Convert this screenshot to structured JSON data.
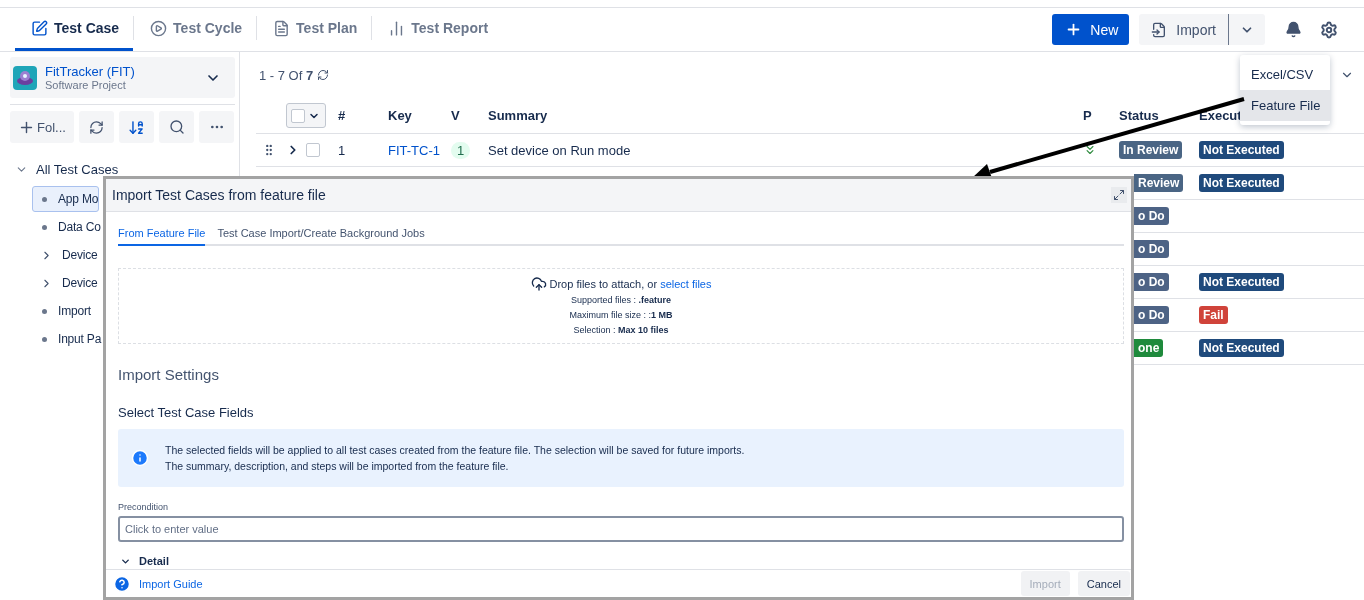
{
  "nav_tabs": [
    {
      "label": "Test Case",
      "selected": true
    },
    {
      "label": "Test Cycle",
      "selected": false
    },
    {
      "label": "Test Plan",
      "selected": false
    },
    {
      "label": "Test Report",
      "selected": false
    }
  ],
  "header_actions": {
    "new_button": "New",
    "import_button": "Import"
  },
  "import_menu": {
    "items": [
      {
        "label": "Excel/CSV",
        "selected": false
      },
      {
        "label": "Feature File",
        "selected": true
      }
    ]
  },
  "project": {
    "name": "FitTracker (FIT)",
    "type": "Software Project"
  },
  "sidebar_toolbar": {
    "folder_button": "Fol..."
  },
  "tree": {
    "label": "All Test Cases",
    "expanded": true,
    "children": [
      {
        "label": "App Mo",
        "kind": "leaf",
        "selected": true
      },
      {
        "label": "Data Co",
        "kind": "leaf",
        "selected": false
      },
      {
        "label": "Device",
        "kind": "folder",
        "selected": false
      },
      {
        "label": "Device",
        "kind": "folder",
        "selected": false
      },
      {
        "label": "Import",
        "kind": "leaf",
        "selected": false
      },
      {
        "label": "Input Pa",
        "kind": "leaf",
        "selected": false
      }
    ]
  },
  "count": "1 - 7 Of **7**",
  "table": {
    "columns": [
      "#",
      "Key",
      "V",
      "Summary",
      "P",
      "Status",
      "Execut"
    ],
    "rows": [
      {
        "kind": "full",
        "checked": false,
        "number": "1",
        "key": "FIT-TC-1",
        "version": "1",
        "summary": "Set device on Run mode",
        "status": {
          "text": "In Review",
          "color": "#4a6584"
        },
        "execution": {
          "text": "Not Executed",
          "color": "#1f4a7c"
        }
      },
      {
        "kind": "partial",
        "status": {
          "text": "Review",
          "color": "#4a6584"
        },
        "execution": {
          "text": "Not Executed",
          "color": "#1f4a7c"
        }
      },
      {
        "kind": "partial",
        "status": {
          "text": "o Do",
          "color": "#4d6385"
        }
      },
      {
        "kind": "partial",
        "status": {
          "text": "o Do",
          "color": "#4d6385"
        }
      },
      {
        "kind": "partial",
        "status": {
          "text": "o Do",
          "color": "#4d6385"
        },
        "execution": {
          "text": "Not Executed",
          "color": "#1f4a7c"
        }
      },
      {
        "kind": "partial",
        "status": {
          "text": "o Do",
          "color": "#4d6385"
        },
        "execution": {
          "text": "Fail",
          "color": "#d0433a"
        }
      },
      {
        "kind": "partial",
        "status": {
          "text": "one",
          "color": "#1e8a3c"
        },
        "execution": {
          "text": "Not Executed",
          "color": "#1f4a7c"
        }
      }
    ]
  },
  "dialog": {
    "title": "Import Test Cases from feature file",
    "tabs": [
      {
        "label": "From Feature File",
        "selected": true
      },
      {
        "label": "Test Case Import/Create Background Jobs",
        "selected": false
      }
    ],
    "dropzone": {
      "prompt": "Drop files to attach, or",
      "link": "select files",
      "lines": [
        "Supported files : **.feature**",
        "Maximum file size : :**1 MB**",
        "Selection : **Max 10 files**"
      ]
    },
    "settings_title": "Import Settings",
    "fields_title": "Select Test Case Fields",
    "info": [
      "The selected fields will be applied to all test cases created from the feature file. The selection will be saved for future imports.",
      "The summary, description, and steps will be imported from the feature file."
    ],
    "precondition": {
      "label": "Precondition",
      "placeholder": "Click to enter value"
    },
    "detail": {
      "label": "Detail",
      "expanded": true
    },
    "guide_link": "Import Guide",
    "buttons": [
      {
        "label": "Import",
        "disabled": true
      },
      {
        "label": "Cancel",
        "disabled": false
      }
    ]
  }
}
